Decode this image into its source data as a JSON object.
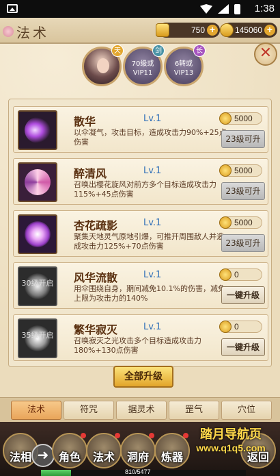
{
  "status_bar": {
    "time": "1:38"
  },
  "header": {
    "title": "法术",
    "gold": "750",
    "coins": "145060",
    "close_icon": "close-x-icon"
  },
  "avatars": [
    {
      "tag": "天",
      "locked": false,
      "text": ""
    },
    {
      "tag": "剑",
      "locked": true,
      "text_line1": "70级或",
      "text_line2": "VIP11"
    },
    {
      "tag": "长",
      "locked": true,
      "text_line1": "6转或",
      "text_line2": "VIP13"
    }
  ],
  "skills": [
    {
      "name": "散华",
      "level": "Lv.1",
      "cost": "5000",
      "desc": "以伞凝气，攻击目标，造成攻击力90%+25点伤害",
      "button": "23级可升",
      "button_state": "disabled",
      "icon": "purple-slash-icon",
      "icon_label": ""
    },
    {
      "name": "醉清风",
      "level": "Lv.1",
      "cost": "5000",
      "desc": "召唤出樱花旋风对前方多个目标造成攻击力115%+45点伤害",
      "button": "23级可升",
      "button_state": "disabled",
      "icon": "pink-whirlwind-icon",
      "icon_label": ""
    },
    {
      "name": "杏花疏影",
      "level": "Lv.1",
      "cost": "5000",
      "desc": "聚集天地灵气原地引爆，可推开周围敌人并造成攻击力125%+70点伤害",
      "button": "23级可升",
      "button_state": "disabled",
      "icon": "lotus-icon",
      "icon_label": ""
    },
    {
      "name": "风华流散",
      "level": "Lv.1",
      "cost": "0",
      "desc": "用伞围绕自身，期间减免10.1%的伤害，减免上限为攻击力的140%",
      "button": "一键升级",
      "button_state": "active",
      "icon": "umbrella-shield-icon",
      "icon_label": "30级开启"
    },
    {
      "name": "繁华寂灭",
      "level": "Lv.1",
      "cost": "0",
      "desc": "召唤寂灭之光攻击多个目标造成攻击力180%+130点伤害",
      "button": "一键升级",
      "button_state": "active",
      "icon": "light-burst-icon",
      "icon_label": "35级开启"
    }
  ],
  "upgrade_all_label": "全部升级",
  "tabs": [
    {
      "label": "法术",
      "active": true
    },
    {
      "label": "符咒",
      "active": false
    },
    {
      "label": "据灵术",
      "active": false
    },
    {
      "label": "罡气",
      "active": false
    },
    {
      "label": "穴位",
      "active": false
    }
  ],
  "bottom_menu": [
    {
      "label": "法相"
    },
    {
      "label": "角色"
    },
    {
      "label": "法术"
    },
    {
      "label": "洞府"
    },
    {
      "label": "炼器"
    },
    {
      "label": "返回"
    }
  ],
  "exp": {
    "text": "810/5477",
    "fraction": 0.148
  },
  "watermark": {
    "line1": "踏月导航页",
    "line2": "www.q1q5.com"
  },
  "colors": {
    "accent_gold": "#e2a52a",
    "level_blue": "#2f6fb8",
    "tab_active": "#e9a55a"
  }
}
